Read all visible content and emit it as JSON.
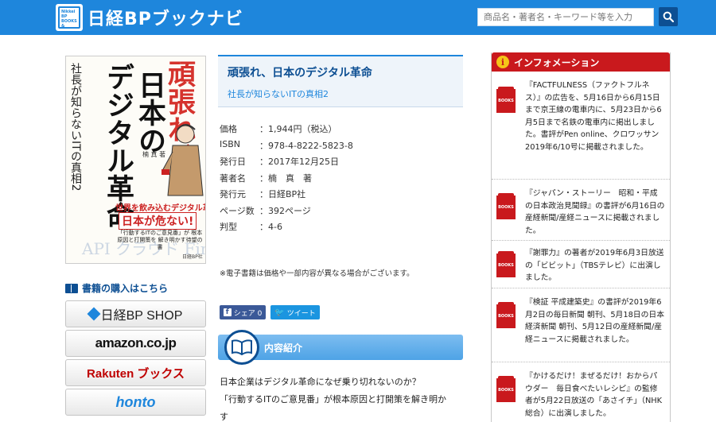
{
  "header": {
    "logo_badge": "Nikkei BP BOOKS & eBOOKS",
    "logo_text": "日経BPブックナビ",
    "search_placeholder": "商品名・著者名・キーワード等を入力",
    "search_icon": "search-icon"
  },
  "cover": {
    "line_red": "頑張れ、",
    "line_black1": "日本の",
    "line_black2": "デジタル革命",
    "subtitle": "社長が知らないITの真相2",
    "author": "楠 真 著",
    "tagline1": "世界を飲み込むデジタル革命、",
    "tagline2": "日本が危ない!",
    "tagline3": "「行動するITのご意見番」が 根本原因と打開策を 解き明かす待望の書",
    "bg_words": "API クラウド FinTech",
    "publisher": "日経BP社"
  },
  "buy": {
    "title": "書籍の購入はこちら",
    "shops": [
      {
        "label": "日経BP SHOP"
      },
      {
        "label": "amazon.co.jp"
      },
      {
        "label": "Rakuten ブックス"
      },
      {
        "label": "honto"
      }
    ]
  },
  "book": {
    "title": "頑張れ、日本のデジタル革命",
    "subtitle": "社長が知らないITの真相2",
    "info": [
      {
        "label": "価格",
        "value": "：1,944円（税込）"
      },
      {
        "label": "ISBN",
        "value": "：978-4-8222-5823-8"
      },
      {
        "label": "発行日",
        "value": "：2017年12月25日"
      },
      {
        "label": "著者名",
        "value": "：楠　真　著"
      },
      {
        "label": "発行元",
        "value": "：日経BP社"
      },
      {
        "label": "ページ数",
        "value": "：392ページ"
      },
      {
        "label": "判型",
        "value": "：4-6"
      }
    ],
    "note": "※電子書籍は価格や一部内容が異なる場合がございます。",
    "share_fb": "シェア 0",
    "share_tw": "ツイート",
    "section_title": "内容紹介",
    "desc_line1": "日本企業はデジタル革命になぜ乗り切れないのか？",
    "desc_line2": "「行動するITのご意見番」が根本原因と打開策を解き明か",
    "desc_line3": "す"
  },
  "information": {
    "title": "インフォメーション",
    "icon_label": "BOOKS",
    "items": [
      {
        "text": "『FACTFULNESS（ファクトフルネス）』の広告を、5月16日から6月15日まで京王線の電車内に、5月23日から6月5日まで名鉄の電車内に掲出しました。書評がPen online、クロワッサン 2019年6/10号に掲載されました。"
      },
      {
        "text": "『ジャパン・ストーリー　昭和・平成の日本政治見聞録』の書評が6月16日の産経新聞/産経ニュースに掲載されました。"
      },
      {
        "text": "『謝罪力』の著者が2019年6月3日放送の「ビビット」（TBSテレビ）に出演しました。"
      },
      {
        "text": "『検証 平成建築史』の書評が2019年6月2日の毎日新聞 朝刊、5月18日の日本経済新聞 朝刊、5月12日の産経新聞/産経ニュースに掲載されました。"
      },
      {
        "text": "『かけるだけ！まぜるだけ！おからパウダー　毎日食べたいレシピ』の監修者が5月22日放送の「あさイチ」（NHK総合）に出演しました。"
      }
    ]
  }
}
